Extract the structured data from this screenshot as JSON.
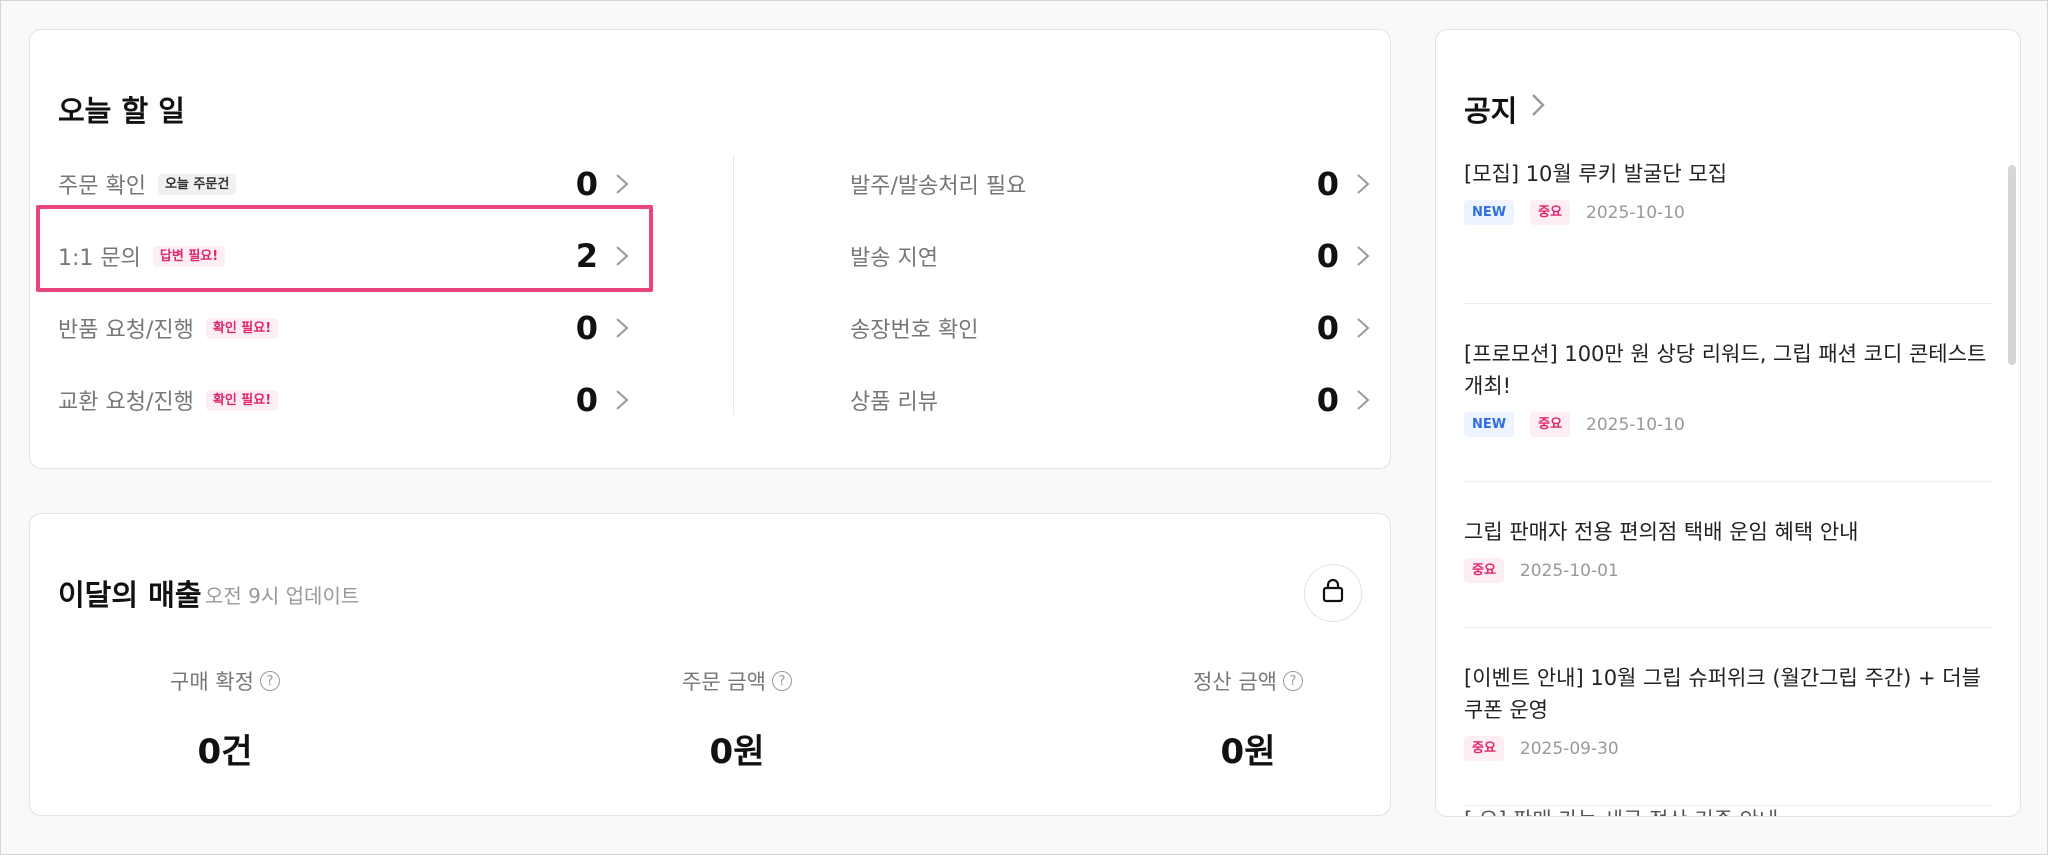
{
  "todo": {
    "title": "오늘 할 일",
    "left": [
      {
        "label": "주문 확인",
        "badge": "오늘 주문건",
        "badge_style": "gray",
        "count": "0"
      },
      {
        "label": "1:1 문의",
        "badge": "답변 필요!",
        "badge_style": "pink",
        "count": "2"
      },
      {
        "label": "반품 요청/진행",
        "badge": "확인 필요!",
        "badge_style": "pink",
        "count": "0"
      },
      {
        "label": "교환 요청/진행",
        "badge": "확인 필요!",
        "badge_style": "pink",
        "count": "0"
      }
    ],
    "right": [
      {
        "label": "발주/발송처리 필요",
        "count": "0"
      },
      {
        "label": "발송 지연",
        "count": "0"
      },
      {
        "label": "송장번호 확인",
        "count": "0"
      },
      {
        "label": "상품 리뷰",
        "count": "0"
      }
    ]
  },
  "sales": {
    "title": "이달의 매출",
    "subtitle": "오전 9시 업데이트",
    "stats": [
      {
        "label": "구매 확정",
        "value": "0건"
      },
      {
        "label": "주문 금액",
        "value": "0원"
      },
      {
        "label": "정산 금액",
        "value": "0원"
      }
    ]
  },
  "notice": {
    "title": "공지",
    "items": [
      {
        "title": "[모집] 10월 루키 발굴단 모집",
        "tags": [
          "NEW",
          "중요"
        ],
        "date": "2025-10-10"
      },
      {
        "title": "[프로모션] 100만 원 상당 리워드, 그립 패션 코디 콘테스트 개최!",
        "tags": [
          "NEW",
          "중요"
        ],
        "date": "2025-10-10"
      },
      {
        "title": "그립 판매자 전용 편의점 택배 운임 혜택 안내",
        "tags": [
          "중요"
        ],
        "date": "2025-10-01"
      },
      {
        "title": "[이벤트 안내] 10월 그립 슈퍼위크 (월간그립 주간) + 더블 쿠폰 운영",
        "tags": [
          "중요"
        ],
        "date": "2025-09-30"
      }
    ],
    "partial_text": "[ 오] 판매 가능 세금 정산 기준 안내"
  },
  "colors": {
    "accent_pink": "#e0266f",
    "highlight_border": "#e8447e",
    "new_blue": "#2f6fe0"
  }
}
